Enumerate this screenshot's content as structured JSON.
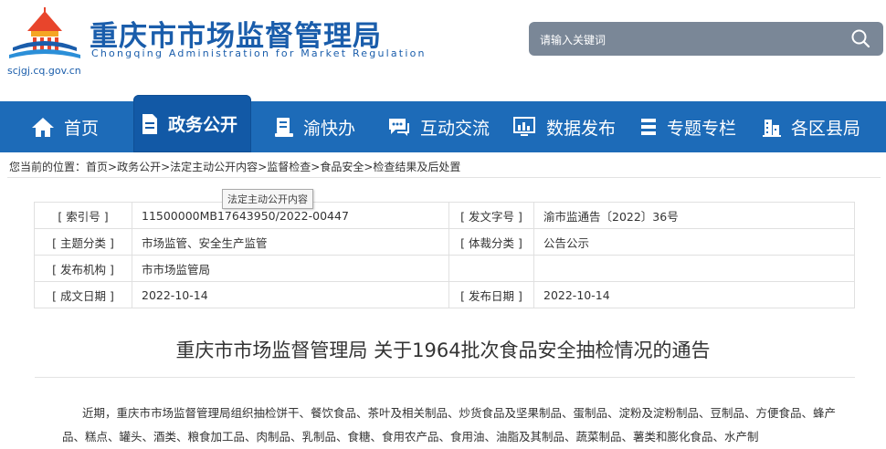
{
  "header": {
    "title_cn": "重庆市市场监督管理局",
    "title_en": "Chongqing Administration for Market Regulation",
    "domain": "scjgj.cq.gov.cn"
  },
  "search": {
    "placeholder": "请输入关键词",
    "icon": "search-icon"
  },
  "nav": {
    "items": [
      {
        "label": "首页",
        "icon": "home-icon"
      },
      {
        "label": "政务公开",
        "icon": "document-icon",
        "active": true
      },
      {
        "label": "渝快办",
        "icon": "service-icon"
      },
      {
        "label": "互动交流",
        "icon": "chat-icon"
      },
      {
        "label": "数据发布",
        "icon": "chart-icon"
      },
      {
        "label": "专题专栏",
        "icon": "list-icon"
      },
      {
        "label": "各区县局",
        "icon": "building-icon"
      }
    ]
  },
  "breadcrumb": {
    "prefix": "您当前的位置：",
    "items": [
      "首页",
      "政务公开",
      "法定主动公开内容",
      "监督检查",
      "食品安全",
      "检查结果及后处置"
    ],
    "separator": ">"
  },
  "tooltip": "法定主动公开内容",
  "info": {
    "index_label": "[ 索引号 ]",
    "index_value": "11500000MB17643950/2022-00447",
    "doc_no_label": "[ 发文字号 ]",
    "doc_no_value": "渝市监通告〔2022〕36号",
    "topic_label": "[ 主题分类 ]",
    "topic_value": "市场监管、安全生产监管",
    "genre_label": "[ 体裁分类 ]",
    "genre_value": "公告公示",
    "issuer_label": "[ 发布机构 ]",
    "issuer_value": "市市场监管局",
    "created_label": "[ 成文日期 ]",
    "created_value": "2022-10-14",
    "published_label": "[ 发布日期 ]",
    "published_value": "2022-10-14"
  },
  "article": {
    "title": "重庆市市场监督管理局 关于1964批次食品安全抽检情况的通告",
    "body": "近期，重庆市市场监督管理局组织抽检饼干、餐饮食品、茶叶及相关制品、炒货食品及坚果制品、蛋制品、淀粉及淀粉制品、豆制品、方便食品、蜂产品、糕点、罐头、酒类、粮食加工品、肉制品、乳制品、食糖、食用农产品、食用油、油脂及其制品、蔬菜制品、薯类和膨化食品、水产制"
  },
  "colors": {
    "brand_blue": "#1a5dab",
    "nav_bg": "#1d6bb8",
    "nav_active": "#1259a6",
    "search_bg": "#7a8797"
  }
}
